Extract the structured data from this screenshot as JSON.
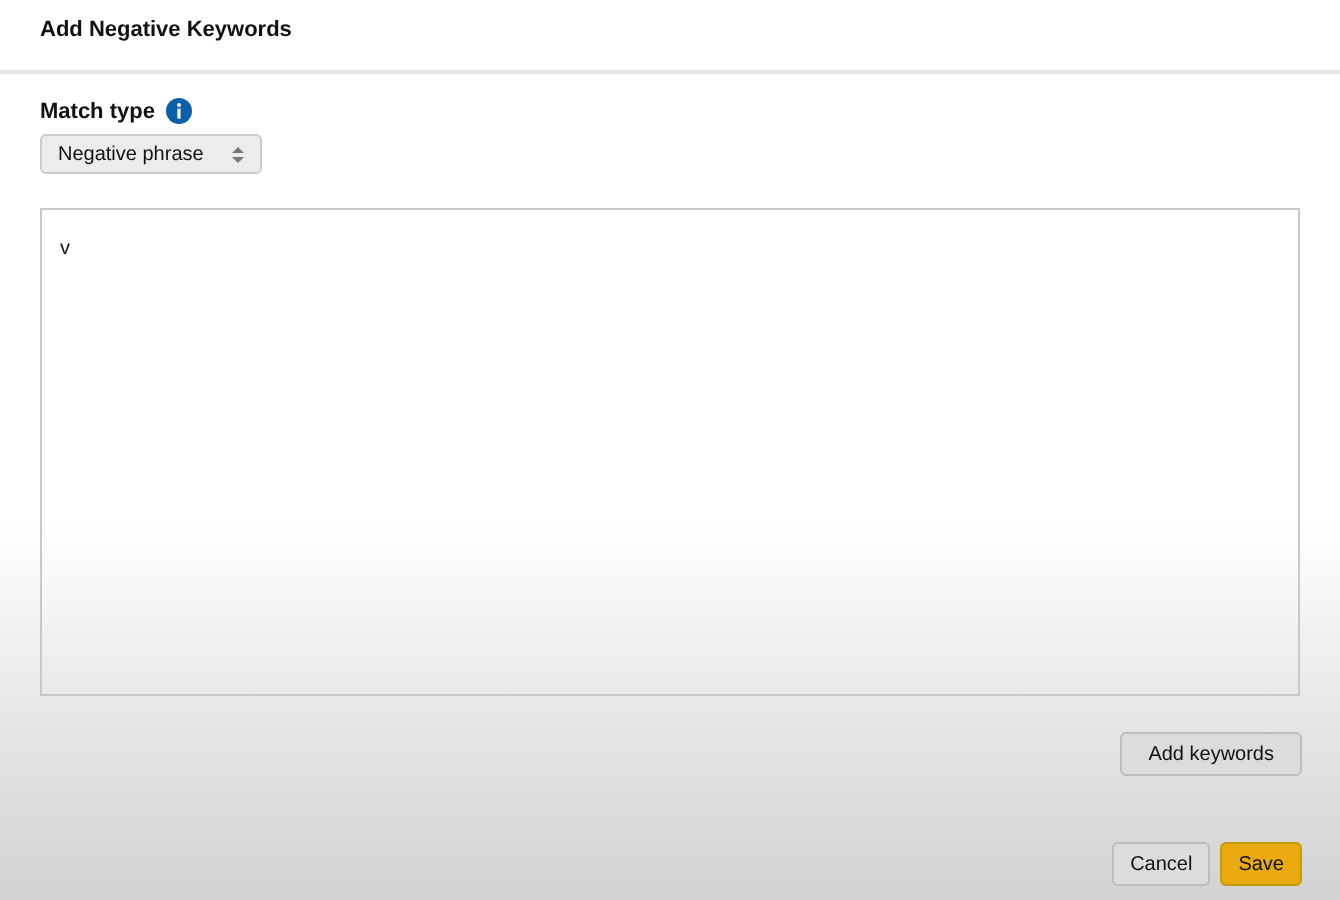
{
  "dialog": {
    "title": "Add Negative Keywords"
  },
  "match_type": {
    "label": "Match type",
    "value": "Negative phrase"
  },
  "keywords": {
    "value": "v"
  },
  "add_button": "Add keywords",
  "buttons": [
    {
      "label": "Cancel",
      "kind": "secondary"
    },
    {
      "label": "Save",
      "kind": "primary"
    }
  ]
}
